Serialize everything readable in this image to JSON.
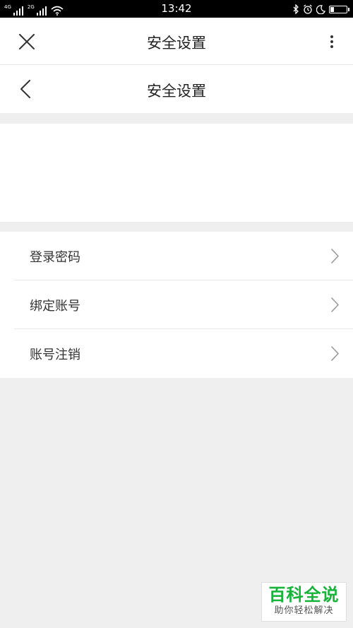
{
  "status_bar": {
    "time": "13:42",
    "signal_1_label": "4G",
    "signal_2_label": "2G",
    "icons": [
      "signal-icon",
      "wifi-icon",
      "bluetooth-icon",
      "alarm-icon",
      "moon-icon",
      "battery-icon"
    ],
    "battery_level": 0.25
  },
  "outer_header": {
    "title": "安全设置",
    "close_icon": "close-icon",
    "more_icon": "more-vertical-icon"
  },
  "inner_header": {
    "title": "安全设置",
    "back_icon": "back-arrow-icon"
  },
  "menu": {
    "items": [
      {
        "label": "登录密码"
      },
      {
        "label": "绑定账号"
      },
      {
        "label": "账号注销"
      }
    ],
    "chevron_icon": "chevron-right-icon"
  },
  "watermark": {
    "title": "百科全说",
    "subtitle": "助你轻松解决"
  },
  "colors": {
    "background": "#efefef",
    "watermark_green": "#17b33a"
  }
}
